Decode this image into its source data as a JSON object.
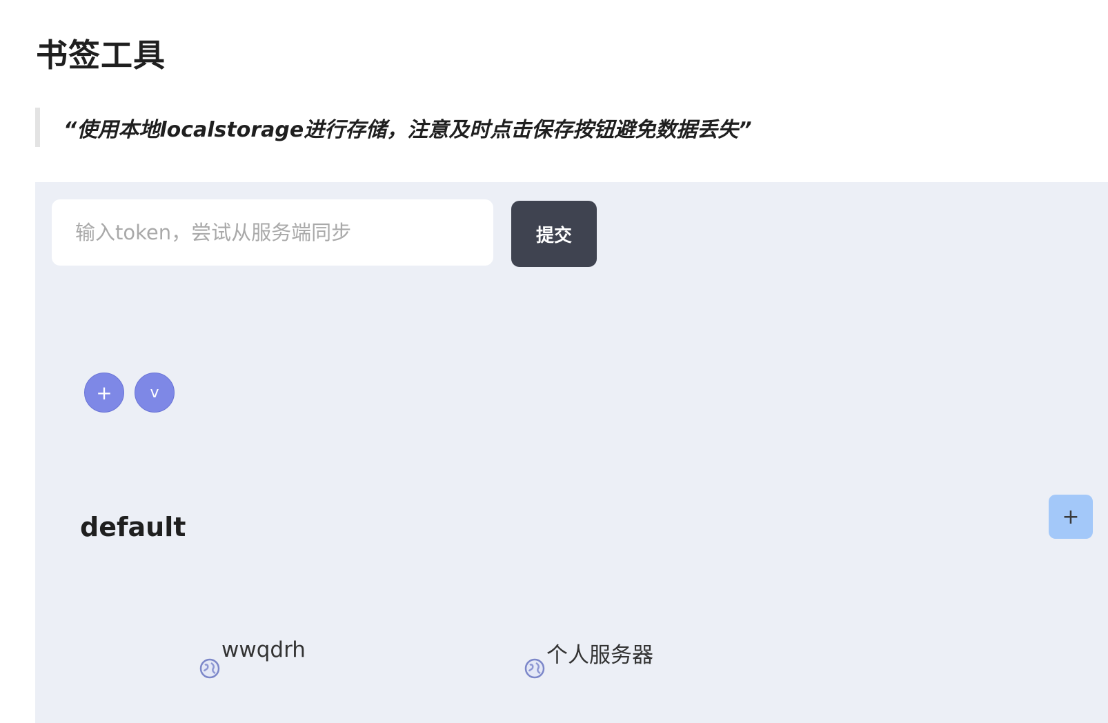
{
  "header": {
    "title": "书签工具",
    "quote": "“使用本地localstorage进行存储，注意及时点击保存按钮避免数据丢失”"
  },
  "sync": {
    "placeholder": "输入token，尝试从服务端同步",
    "value": "",
    "submit_label": "提交"
  },
  "controls": {
    "add_label": "+",
    "toggle_label": "v"
  },
  "groups": [
    {
      "name": "default",
      "add_label": "+",
      "bookmarks": [
        {
          "label": "wwqdrh",
          "icon": "globe-icon"
        },
        {
          "label": "个人服务器",
          "icon": "globe-icon"
        }
      ]
    }
  ],
  "colors": {
    "panel_bg": "#eceff6",
    "submit_bg": "#3f4350",
    "circle_btn_bg": "#7e88e6",
    "group_add_bg": "#a3c8f9"
  }
}
